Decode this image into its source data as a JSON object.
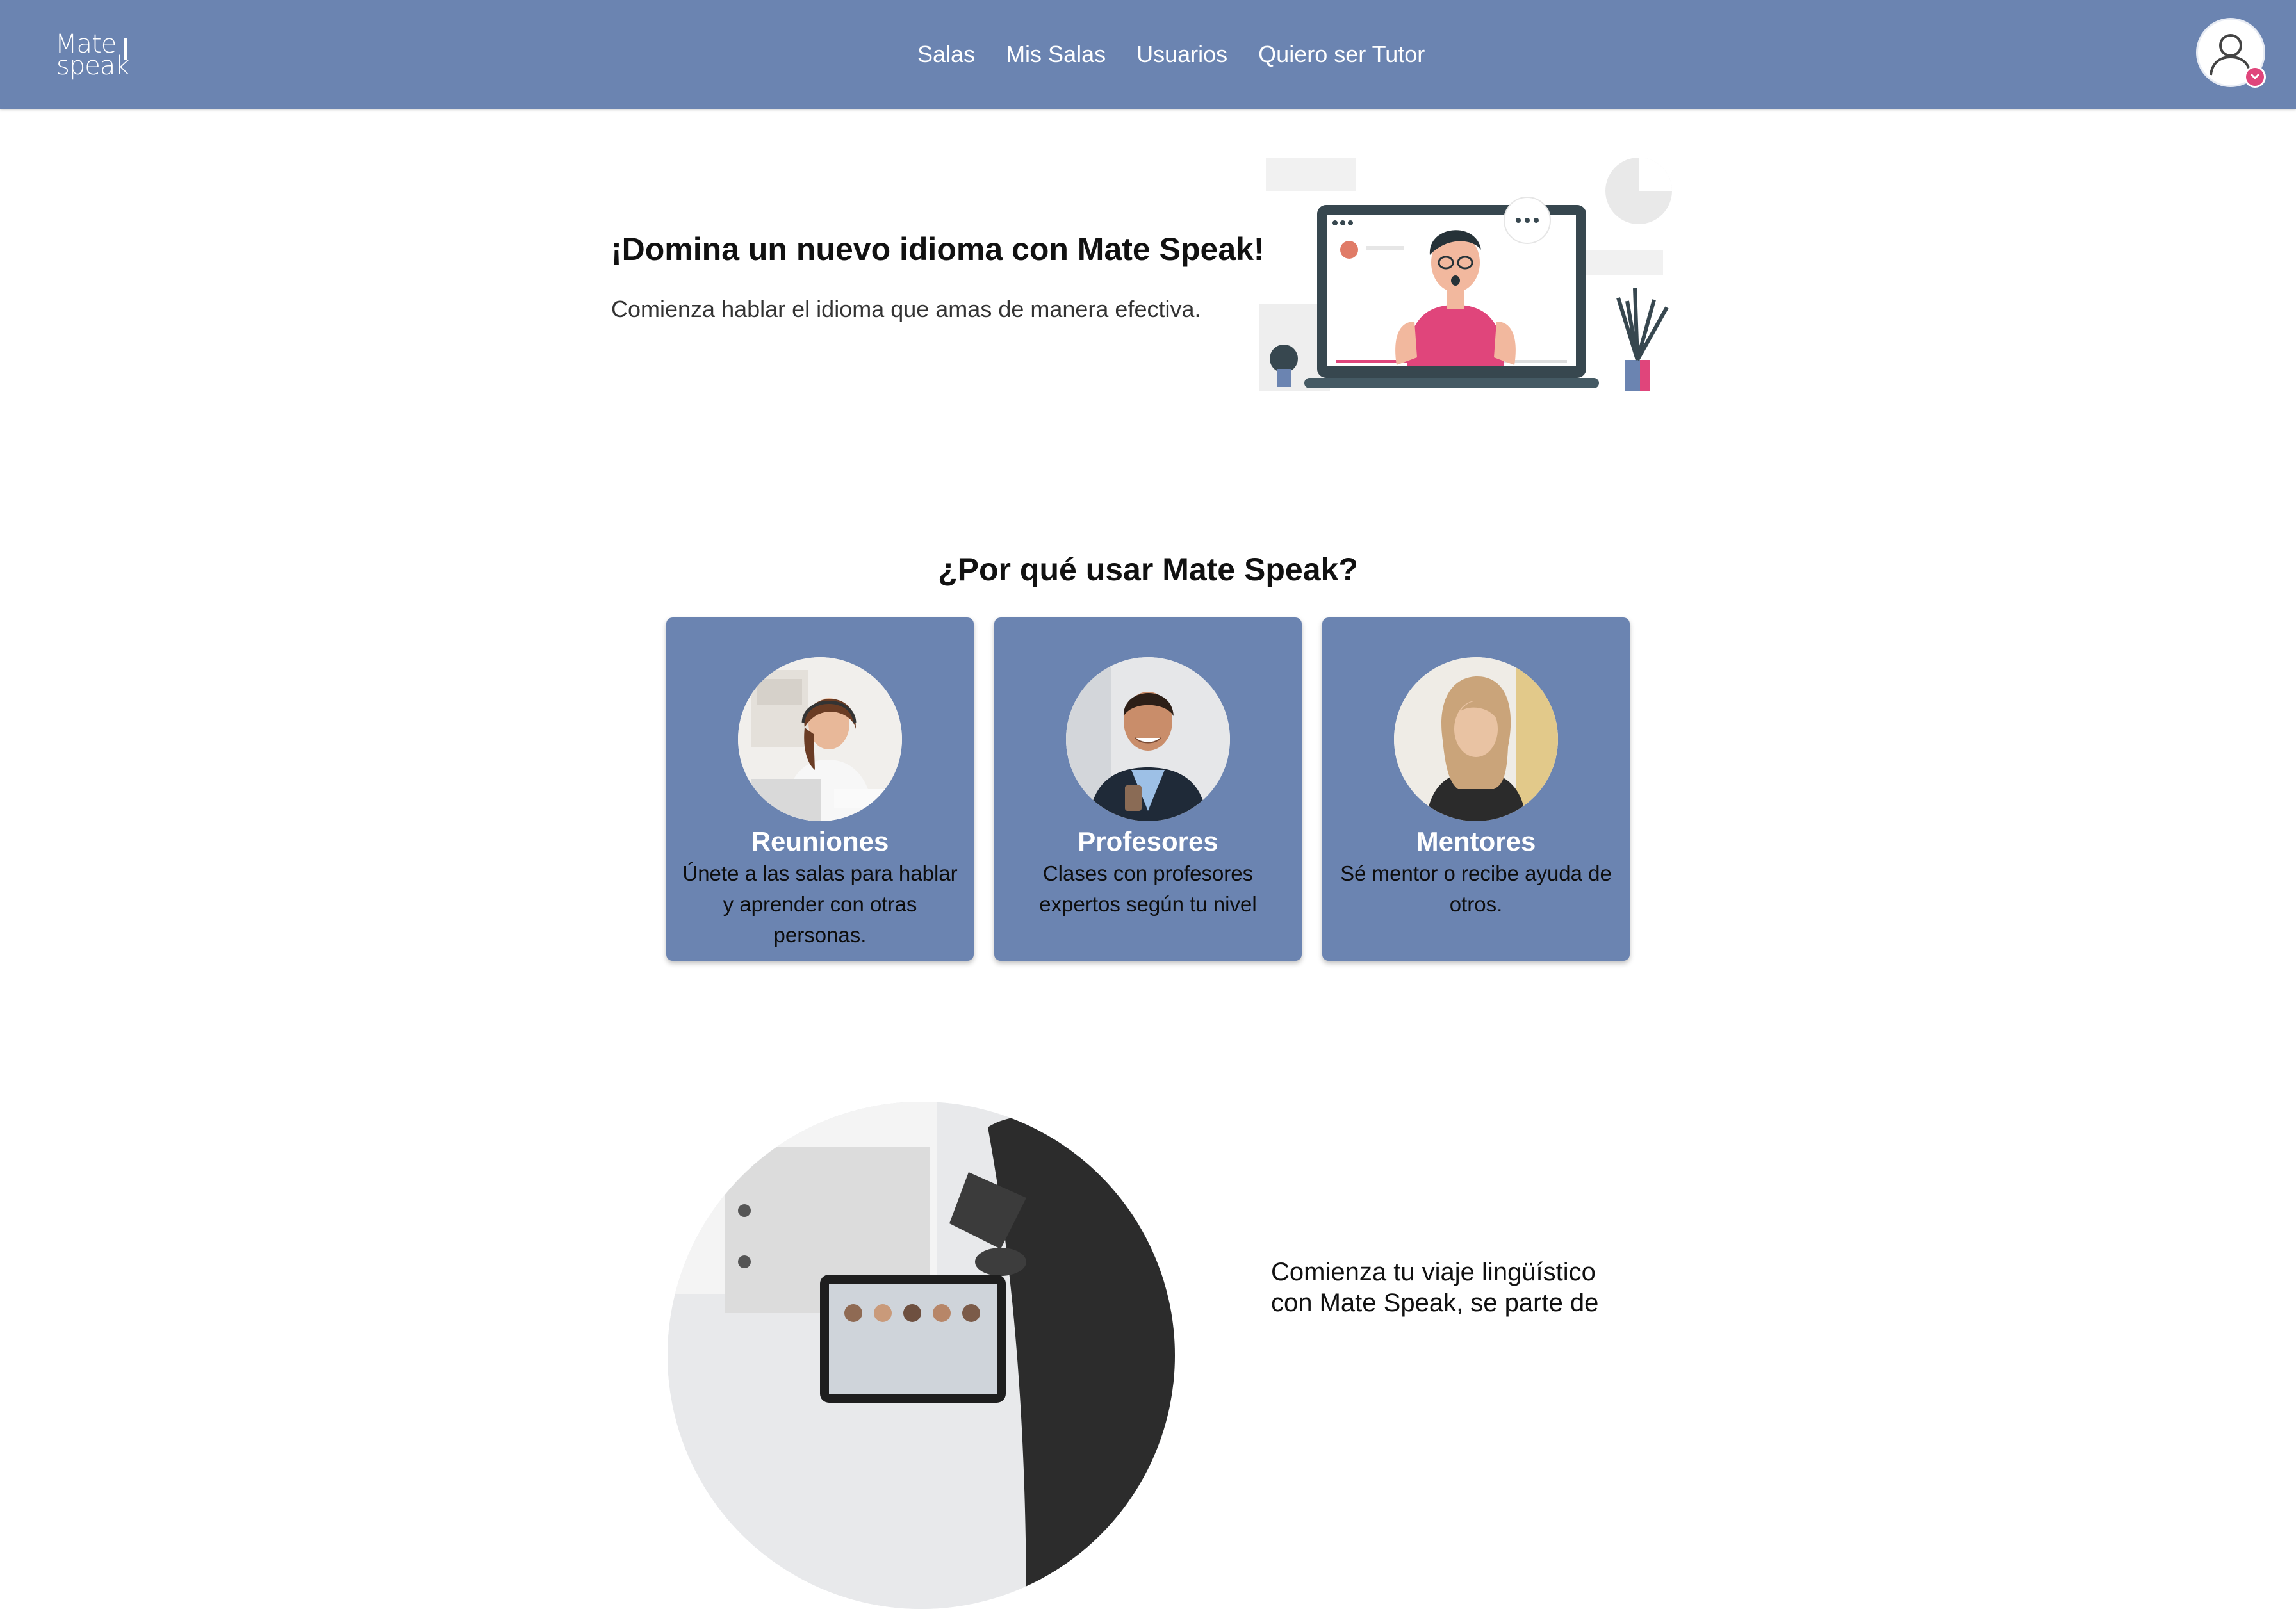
{
  "brand": {
    "logo_line1": "Mate",
    "logo_line2": "speak"
  },
  "nav": {
    "links": [
      {
        "label": "Salas"
      },
      {
        "label": "Mis Salas"
      },
      {
        "label": "Usuarios"
      },
      {
        "label": "Quiero ser Tutor"
      }
    ]
  },
  "profile": {
    "icon": "user-avatar-icon",
    "badge_icon": "chevron-down-icon"
  },
  "hero": {
    "title": "¡Domina un nuevo idioma con Mate Speak!",
    "subtitle": "Comienza hablar el idioma que amas de manera efectiva."
  },
  "why": {
    "title": "¿Por qué usar Mate Speak?",
    "cards": [
      {
        "title": "Reuniones",
        "text": "Únete a las salas para hablar y aprender con otras personas."
      },
      {
        "title": "Profesores",
        "text": "Clases con profesores expertos según tu nivel"
      },
      {
        "title": "Mentores",
        "text": "Sé mentor o recibe ayuda de otros."
      }
    ]
  },
  "journey": {
    "text": "Comienza tu viaje lingüístico con Mate Speak, se parte de"
  },
  "colors": {
    "primary": "#6b84b1",
    "accent": "#e0457b",
    "text": "#111111"
  }
}
